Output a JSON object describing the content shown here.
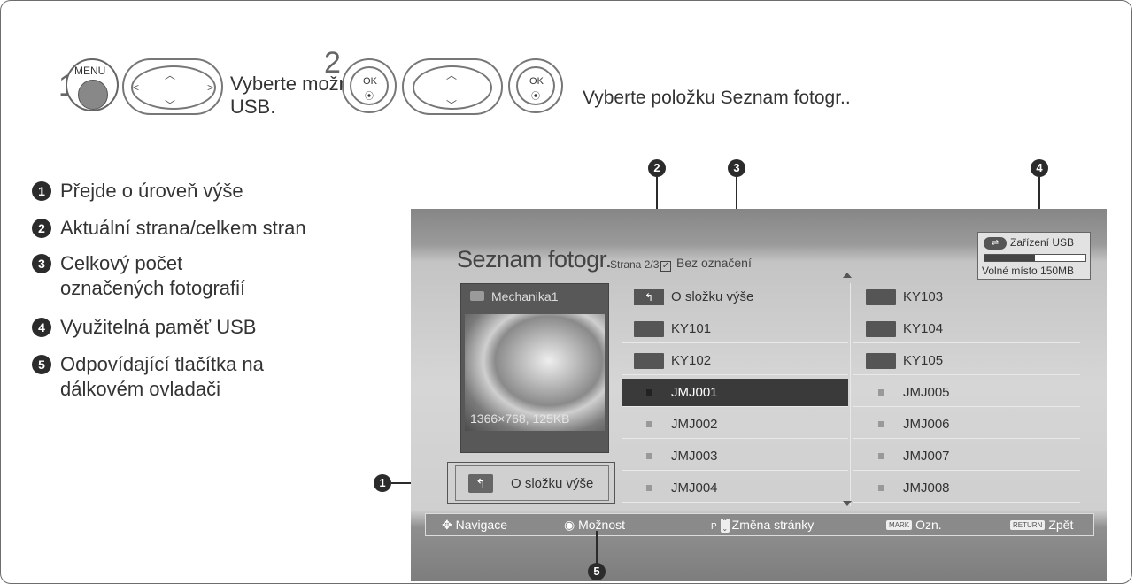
{
  "steps": [
    {
      "number": "1",
      "buttons": {
        "menu": "MENU"
      },
      "instruction": [
        "Vyberte možnost",
        "USB."
      ]
    },
    {
      "number": "2",
      "buttons": {
        "ok1": "OK",
        "ok2": "OK"
      },
      "instruction": "Vyberte položku Seznam fotogr.."
    }
  ],
  "legend": [
    {
      "num": "1",
      "text": "Přejde o  úroveň výše"
    },
    {
      "num": "2",
      "text": "Aktuální strana/celkem stran"
    },
    {
      "num": "3",
      "text": "Celkový počet označených fotografií"
    },
    {
      "num": "4",
      "text": "Využitelná paměť USB"
    },
    {
      "num": "5",
      "text": "Odpovídající tlačítka na dálkovém ovladači"
    }
  ],
  "callouts": [
    "1",
    "2",
    "3",
    "4",
    "5"
  ],
  "screen": {
    "title": "Seznam fotogr.",
    "page": "Strana 2/3",
    "mark_status": "Bez označení",
    "usb": {
      "label": "Zařízení USB",
      "free": "Volné místo 150MB",
      "used_fraction": 0.5
    },
    "preview": {
      "folder": "Mechanika1",
      "info": "1366×768, 125KB"
    },
    "up_button": "O složku výše",
    "left_column": [
      {
        "label": "O složku výše",
        "kind": "up"
      },
      {
        "label": "KY101",
        "kind": "folder"
      },
      {
        "label": "KY102",
        "kind": "folder"
      },
      {
        "label": "JMJ001",
        "kind": "photo",
        "selected": true
      },
      {
        "label": "JMJ002",
        "kind": "photo"
      },
      {
        "label": "JMJ003",
        "kind": "photo"
      },
      {
        "label": "JMJ004",
        "kind": "photo"
      }
    ],
    "right_column": [
      {
        "label": "KY103",
        "kind": "folder"
      },
      {
        "label": "KY104",
        "kind": "folder"
      },
      {
        "label": "KY105",
        "kind": "folder"
      },
      {
        "label": "JMJ005",
        "kind": "photo"
      },
      {
        "label": "JMJ006",
        "kind": "photo"
      },
      {
        "label": "JMJ007",
        "kind": "photo"
      },
      {
        "label": "JMJ008",
        "kind": "photo"
      }
    ],
    "bottom_bar": {
      "navigation": "Navigace",
      "option": "Možnost",
      "page_key": "P",
      "page_change": "Změna stránky",
      "mark_key": "MARK",
      "mark": "Ozn.",
      "return_key": "RETURN",
      "back": "Zpět"
    }
  }
}
